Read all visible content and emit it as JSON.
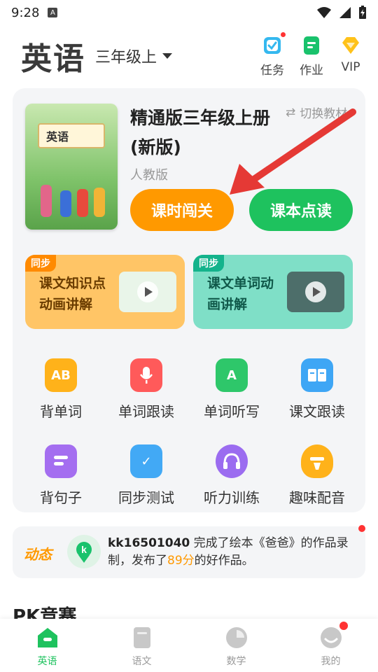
{
  "status_bar": {
    "time": "9:28",
    "app_badge": "A"
  },
  "header": {
    "subject": "英语",
    "grade": "三年级上",
    "icons": [
      {
        "name": "task",
        "label": "任务",
        "has_dot": true,
        "color": "#35b8ef"
      },
      {
        "name": "homework",
        "label": "作业",
        "color": "#19c26c"
      },
      {
        "name": "vip",
        "label": "VIP",
        "color": "#ffc21a"
      }
    ]
  },
  "book": {
    "cover_title": "英语",
    "title": "精通版三年级上册(新版)",
    "publisher": "人教版",
    "switch_label": "切换教材",
    "btn_lesson": "课时闯关",
    "btn_read": "课本点读"
  },
  "videos": [
    {
      "tag": "同步",
      "text": "课文知识点动画讲解"
    },
    {
      "tag": "同步",
      "text": "课文单词动画讲解"
    }
  ],
  "grid": [
    {
      "label": "背单词",
      "icon": "ab-icon",
      "color": "#ffb21a",
      "glyph": "AB"
    },
    {
      "label": "单词跟读",
      "icon": "microphone-icon",
      "color": "#ff5a5a",
      "glyph": ""
    },
    {
      "label": "单词听写",
      "icon": "pen-icon",
      "color": "#2ec76a",
      "glyph": "A"
    },
    {
      "label": "课文跟读",
      "icon": "book-icon",
      "color": "#3ea6f5",
      "glyph": ""
    },
    {
      "label": "背句子",
      "icon": "sentence-icon",
      "color": "#a46ef0",
      "glyph": ""
    },
    {
      "label": "同步测试",
      "icon": "clipboard-icon",
      "color": "#42a9f5",
      "glyph": "✓"
    },
    {
      "label": "听力训练",
      "icon": "headphones-icon",
      "color": "#9b6cf0",
      "glyph": ""
    },
    {
      "label": "趣味配音",
      "icon": "lamp-icon",
      "color": "#ffb21a",
      "glyph": ""
    }
  ],
  "dynamic": {
    "label": "动态",
    "user": "kk16501040",
    "text_before": " 完成了绘本《爸爸》的作品录制，发布了",
    "score": "89分",
    "text_after": "的好作品。"
  },
  "pk_title": "PK竞赛",
  "bottom_nav": [
    {
      "label": "英语",
      "active": true
    },
    {
      "label": "语文"
    },
    {
      "label": "数学"
    },
    {
      "label": "我的",
      "has_dot": true
    }
  ],
  "colors": {
    "accent_orange": "#ff9900",
    "accent_green": "#1ec25e",
    "arrow_red": "#e53935"
  }
}
